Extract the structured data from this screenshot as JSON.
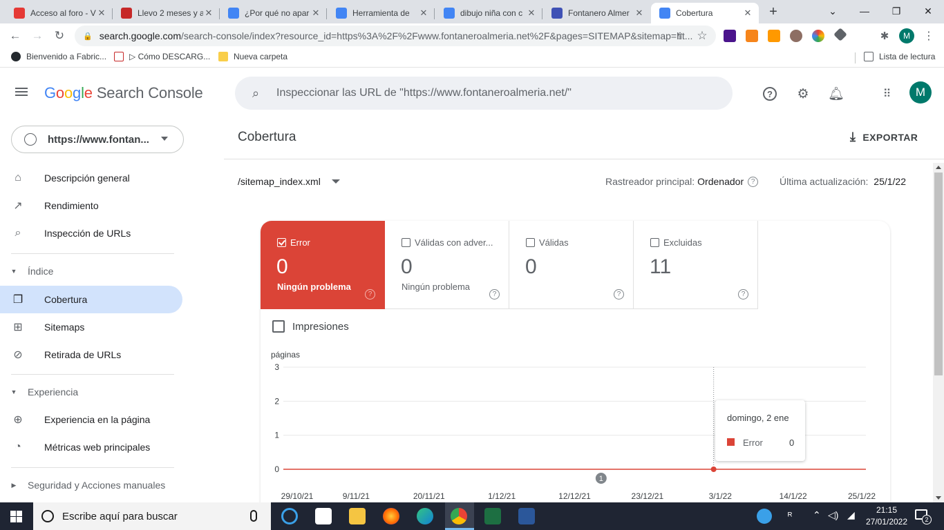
{
  "browser": {
    "tabs": [
      {
        "title": "Acceso al foro - V",
        "favicon": "w-icon",
        "color": "#e53935"
      },
      {
        "title": "Llevo 2 meses y a",
        "favicon": "w-icon",
        "color": "#c62828"
      },
      {
        "title": "¿Por qué no apar",
        "favicon": "google-icon",
        "color": "#4285f4"
      },
      {
        "title": "Herramienta de",
        "favicon": "google-icon",
        "color": "#4285f4"
      },
      {
        "title": "dibujo niña con c",
        "favicon": "google-icon",
        "color": "#4285f4"
      },
      {
        "title": "Fontanero Almer",
        "favicon": "site-icon",
        "color": "#3f51b5"
      },
      {
        "title": "Cobertura",
        "favicon": "search-console-icon",
        "color": "#4285f4"
      }
    ],
    "url_host": "search.google.com",
    "url_rest": "/search-console/index?resource_id=https%3A%2F%2Fwww.fontaneroalmeria.net%2F&pages=SITEMAP&sitemap=ht...",
    "bookmarks": [
      {
        "label": "Bienvenido a Fabric..."
      },
      {
        "label": "▷ Cómo DESCARG..."
      },
      {
        "label": "Nueva carpeta"
      }
    ],
    "reading_list": "Lista de lectura",
    "profile_initial": "M"
  },
  "app": {
    "logo_google": "Google",
    "logo_product": "Search Console",
    "search_placeholder": "Inspeccionar las URL de \"https://www.fontaneroalmeria.net/\"",
    "avatar_initial": "M",
    "property": "https://www.fontan..."
  },
  "sidebar": {
    "items_top": [
      {
        "label": "Descripción general",
        "icon": "home-icon"
      },
      {
        "label": "Rendimiento",
        "icon": "trending-icon"
      },
      {
        "label": "Inspección de URLs",
        "icon": "search-icon"
      }
    ],
    "section_index": "Índice",
    "items_index": [
      {
        "label": "Cobertura",
        "icon": "copy-icon",
        "active": true
      },
      {
        "label": "Sitemaps",
        "icon": "sitemap-icon"
      },
      {
        "label": "Retirada de URLs",
        "icon": "hidden-icon"
      }
    ],
    "section_experience": "Experiencia",
    "items_experience": [
      {
        "label": "Experiencia en la página",
        "icon": "plus-circle-icon"
      },
      {
        "label": "Métricas web principales",
        "icon": "gauge-icon"
      }
    ],
    "section_security": "Seguridad y Acciones manuales"
  },
  "main": {
    "title": "Cobertura",
    "export_label": "EXPORTAR",
    "sitemap": "/sitemap_index.xml",
    "crawler_label": "Rastreador principal:",
    "crawler_value": "Ordenador",
    "updated_label": "Última actualización:",
    "updated_value": "25/1/22",
    "cards": [
      {
        "label": "Error",
        "value": "0",
        "sub": "Ningún problema",
        "checked": true
      },
      {
        "label": "Válidas con adver...",
        "value": "0",
        "sub": "Ningún problema",
        "checked": false
      },
      {
        "label": "Válidas",
        "value": "0",
        "sub": "",
        "checked": false
      },
      {
        "label": "Excluidas",
        "value": "11",
        "sub": "",
        "checked": false
      }
    ],
    "impressions_label": "Impresiones",
    "tooltip": {
      "date": "domingo, 2 ene",
      "series": "Error",
      "value": "0"
    }
  },
  "chart_data": {
    "type": "line",
    "ylabel": "páginas",
    "ylim": [
      0,
      3
    ],
    "yticks": [
      "0",
      "1",
      "2",
      "3"
    ],
    "xtick_labels": [
      "29/10/21",
      "9/11/21",
      "20/11/21",
      "1/12/21",
      "12/12/21",
      "23/12/21",
      "3/1/22",
      "14/1/22",
      "25/1/22"
    ],
    "x_range": [
      "2021-10-29",
      "2022-01-25"
    ],
    "series": [
      {
        "name": "Error",
        "color": "#db4437",
        "x_start": "2021-10-29",
        "x_end": "2022-01-25",
        "value": 0
      }
    ],
    "annotation": {
      "label": "1",
      "date": "2021-12-16"
    },
    "highlight": {
      "date": "2022-01-02",
      "value": 0
    }
  },
  "taskbar": {
    "search_placeholder": "Escribe aquí para buscar",
    "time": "21:15",
    "date": "27/01/2022",
    "notifications": "2"
  }
}
